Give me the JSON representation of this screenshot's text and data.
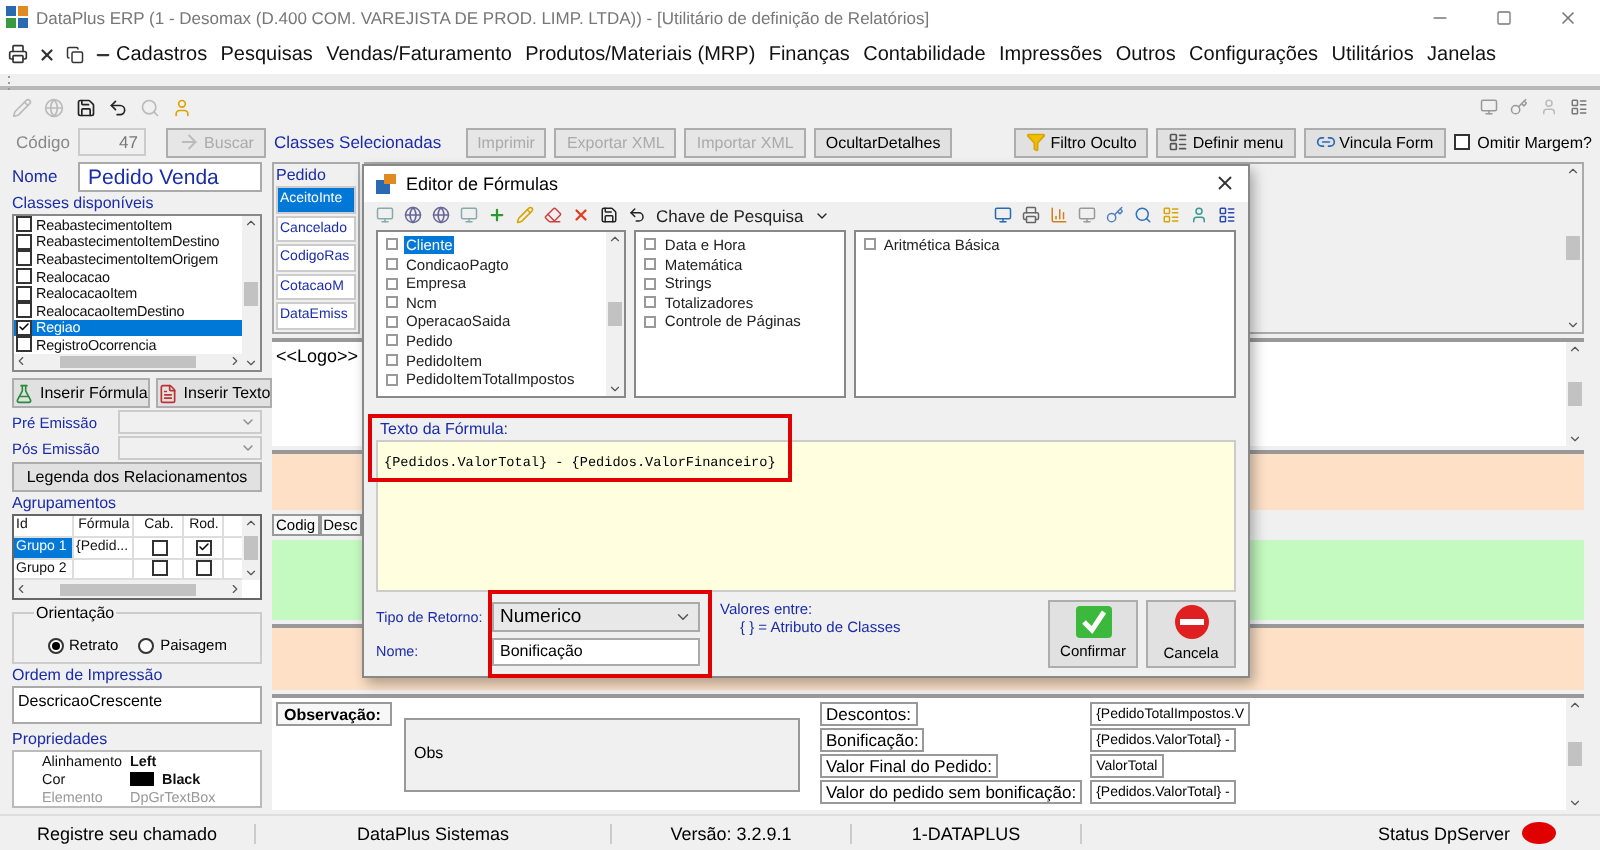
{
  "window": {
    "title": "DataPlus ERP (1 - Desomax   (D.400 COM. VAREJISTA DE PROD. LIMP. LTDA)) - [Utilitário de definição de Relatórios]"
  },
  "menu": [
    "Cadastros",
    "Pesquisas",
    "Vendas/Faturamento",
    "Produtos/Materiais (MRP)",
    "Finanças",
    "Contabilidade",
    "Impressões",
    "Outros",
    "Configurações",
    "Utilitários",
    "Janelas"
  ],
  "form": {
    "codigo_label": "Código",
    "codigo_value": "47",
    "search_button": "Buscar",
    "classes_label": "Classes Selecionadas",
    "actions": [
      {
        "label": "Imprimir",
        "disabled": true
      },
      {
        "label": "Exportar XML",
        "disabled": true
      },
      {
        "label": "Importar XML",
        "disabled": true
      },
      {
        "label": "OcultarDetalhes",
        "disabled": false
      }
    ],
    "tools": [
      {
        "label": "Filtro Oculto",
        "kind": "filter"
      },
      {
        "label": "Definir menu",
        "kind": "menu"
      },
      {
        "label": "Vincula Form",
        "kind": "link"
      }
    ],
    "omit_margin": {
      "label": "Omitir Margem?",
      "checked": false
    }
  },
  "left": {
    "nome_label": "Nome",
    "nome_value": "Pedido Venda",
    "classes_label": "Classes disponíveis",
    "classes": [
      {
        "label": "ReabastecimentoItem",
        "checked": false,
        "selected": false
      },
      {
        "label": "ReabastecimentoItemDestino",
        "checked": false,
        "selected": false
      },
      {
        "label": "ReabastecimentoItemOrigem",
        "checked": false,
        "selected": false
      },
      {
        "label": "Realocacao",
        "checked": false,
        "selected": false
      },
      {
        "label": "RealocacaoItem",
        "checked": false,
        "selected": false
      },
      {
        "label": "RealocacaoItemDestino",
        "checked": false,
        "selected": false
      },
      {
        "label": "Regiao",
        "checked": true,
        "selected": true
      },
      {
        "label": "RegistroOcorrencia",
        "checked": false,
        "selected": false
      }
    ],
    "insert_buttons": [
      {
        "label": "Inserir Fórmula",
        "kind": "formula"
      },
      {
        "label": "Inserir Texto",
        "kind": "text"
      }
    ],
    "emission": [
      "Pré Emissão",
      "Pós Emissão"
    ],
    "legend_button": "Legenda dos Relacionamentos",
    "groups": {
      "title": "Agrupamentos",
      "columns": [
        "Id",
        "Fórmula",
        "Cab.",
        "Rod."
      ],
      "rows": [
        {
          "id": "Grupo 1",
          "formula": "{Pedid...",
          "header": false,
          "footer": true,
          "selected": true
        },
        {
          "id": "Grupo 2",
          "header": false,
          "footer": false,
          "selected": false
        }
      ]
    },
    "orientation": {
      "title": "Orientação",
      "options": [
        {
          "label": "Retrato",
          "selected": true
        },
        {
          "label": "Paisagem",
          "selected": false
        }
      ]
    },
    "order": {
      "title": "Ordem de Impressão",
      "value": "DescricaoCrescente"
    },
    "properties": {
      "title": "Propriedades",
      "rows": [
        {
          "name": "Alinhamento",
          "value": "Left",
          "kind": "text",
          "disabled": false
        },
        {
          "name": "Cor",
          "value": "Black",
          "kind": "color",
          "color": "#000000",
          "disabled": false
        },
        {
          "name": "Elemento",
          "value": "DpGrTextBox",
          "kind": "text",
          "disabled": true
        }
      ]
    }
  },
  "designer": {
    "class_title": "Pedido",
    "class_fields": [
      {
        "label": "AceitoInte",
        "selected": true
      },
      {
        "label": "Cancelado",
        "selected": false
      },
      {
        "label": "CodigoRas",
        "selected": false
      },
      {
        "label": "CotacaoM",
        "selected": false
      },
      {
        "label": "DataEmiss",
        "selected": false
      }
    ],
    "logo": "<<Logo>>",
    "columns": [
      "Codig",
      "Desc"
    ],
    "observation_label": "Observação:",
    "observation_value": "Obs",
    "totals": [
      {
        "label": "Descontos:",
        "value": "{PedidoTotalImpostos.V"
      },
      {
        "label": "Bonificação:",
        "value": "{Pedidos.ValorTotal} -"
      },
      {
        "label": "Valor Final do Pedido:",
        "value": "ValorTotal"
      },
      {
        "label": "Valor do pedido sem bonificação:",
        "value": "{Pedidos.ValorTotal} -"
      }
    ]
  },
  "dialog": {
    "title": "Editor de Fórmulas",
    "search_key": "Chave de Pesquisa",
    "trees": [
      [
        {
          "label": "Cliente",
          "selected": true
        },
        {
          "label": "CondicaoPagto",
          "selected": false
        },
        {
          "label": "Empresa",
          "selected": false
        },
        {
          "label": "Ncm",
          "selected": false
        },
        {
          "label": "OperacaoSaida",
          "selected": false
        },
        {
          "label": "Pedido",
          "selected": false
        },
        {
          "label": "PedidoItem",
          "selected": false
        },
        {
          "label": "PedidoItemTotalImpostos",
          "selected": false
        }
      ],
      [
        {
          "label": "Data e Hora",
          "selected": false
        },
        {
          "label": "Matemática",
          "selected": false
        },
        {
          "label": "Strings",
          "selected": false
        },
        {
          "label": "Totalizadores",
          "selected": false
        },
        {
          "label": "Controle de Páginas",
          "selected": false
        }
      ],
      [
        {
          "label": "Aritmética Básica",
          "selected": false
        }
      ]
    ],
    "formula_label": "Texto da Fórmula:",
    "formula": "{Pedidos.ValorTotal} - {Pedidos.ValorFinanceiro}",
    "return_label": "Tipo de Retorno:",
    "return_value": "Numerico",
    "name_label": "Nome:",
    "name_value": "Bonificação",
    "hint_title": "Valores entre:",
    "hint": "{ } = Atributo de Classes",
    "confirm": "Confirmar",
    "cancel": "Cancela"
  },
  "status_bar": {
    "items": [
      "Registre seu chamado",
      "DataPlus Sistemas",
      "Versão: 3.2.9.1",
      "1-DATAPLUS"
    ],
    "server": {
      "label": "Status DpServer",
      "color": "#e00000"
    }
  }
}
